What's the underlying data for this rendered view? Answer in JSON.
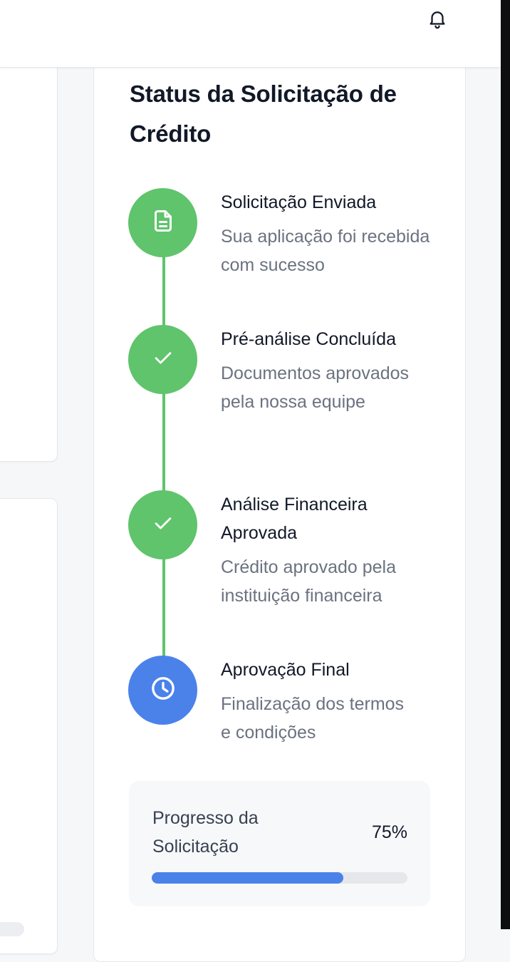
{
  "status": {
    "title": "Status da Solicitação de Crédito",
    "steps": [
      {
        "title": "Solicitação Enviada",
        "desc": "Sua aplicação foi recebida com sucesso",
        "state": "done",
        "icon": "document-icon"
      },
      {
        "title": "Pré-análise Concluída",
        "desc": "Documentos aprovados pela nossa equipe",
        "state": "done",
        "icon": "check-icon"
      },
      {
        "title": "Análise Financeira Aprovada",
        "desc": "Crédito aprovado pela instituição financeira",
        "state": "done",
        "icon": "check-icon"
      },
      {
        "title": "Aprovação Final",
        "desc": "Finalização dos termos e condições",
        "state": "in-progress",
        "icon": "clock-icon"
      }
    ],
    "progress": {
      "label": "Progresso da Solicitação",
      "percent_text": "75%",
      "value": 0.75
    }
  },
  "header": {
    "notification_icon": "bell-icon"
  },
  "colors": {
    "done": "#5fc46b",
    "in_progress": "#4a82ea",
    "progress_track": "#e5e7eb"
  }
}
